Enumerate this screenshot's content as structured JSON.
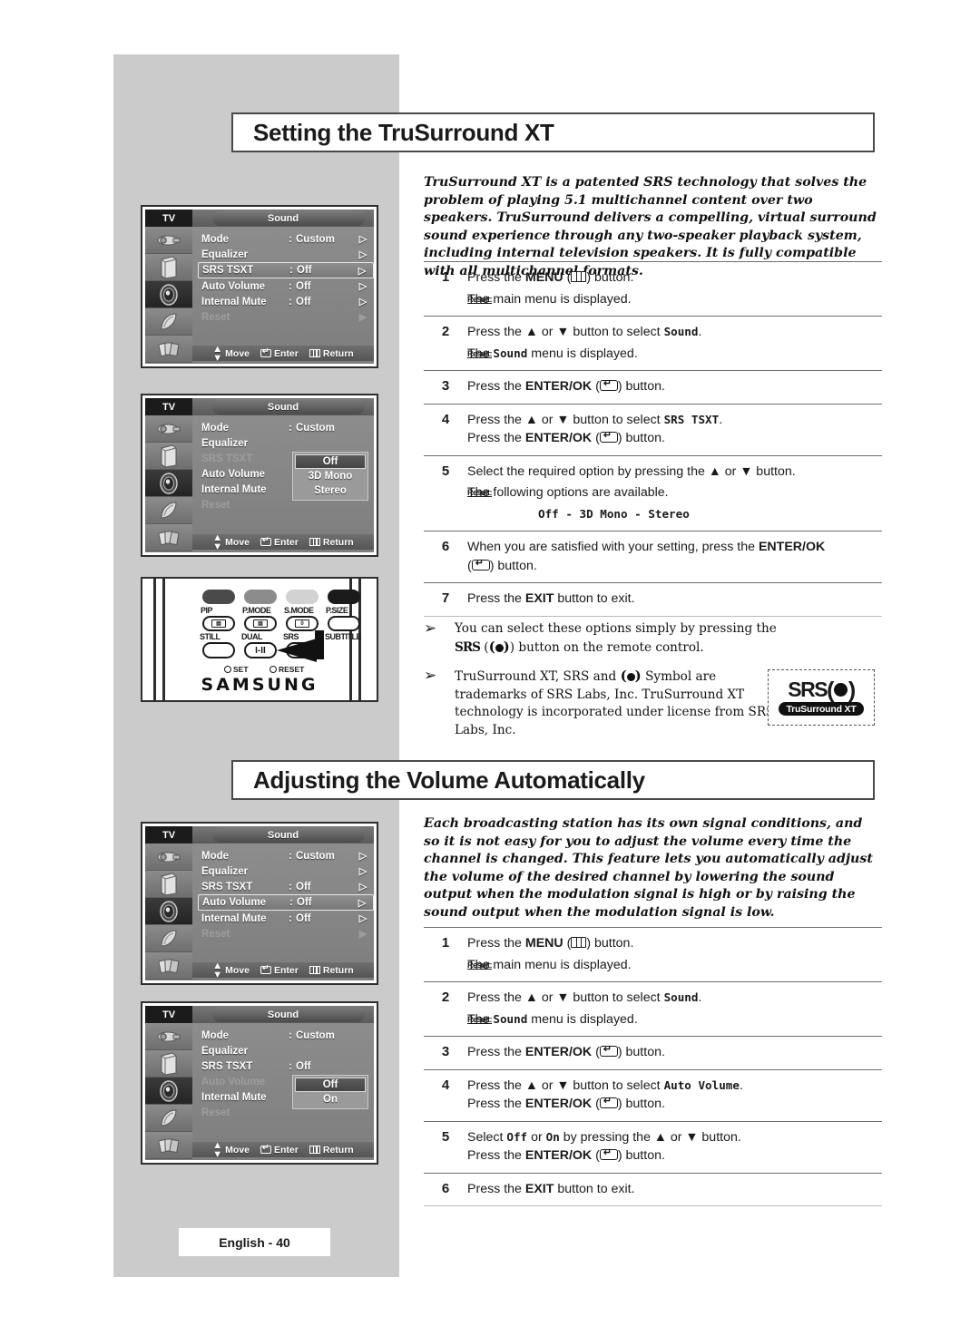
{
  "page": {
    "footer_label": "English - 40",
    "colors": {
      "panel_gray": "#cbcbcb",
      "ink": "#1a1a1a",
      "rule": "#6e6e6e"
    }
  },
  "sections": [
    {
      "title": "Setting the TruSurround XT",
      "intro": "TruSurround XT is a patented SRS technology that solves the problem of playing 5.1 multichannel content over two speakers. TruSurround delivers a compelling, virtual surround sound  experience through any two-speaker playback system, including internal television speakers. It is fully compatible with all multichannel formats."
    },
    {
      "title": "Adjusting the Volume Automatically",
      "intro": "Each broadcasting station has its own signal conditions, and so it is not easy for you to adjust the volume every time the channel  is changed. This feature lets you automatically adjust the volume of the desired channel by lowering the sound output when the modulation signal is high or by raising the sound output when the modulation signal is low."
    }
  ],
  "steps1": {
    "s1_num": "1",
    "s1_a": "Press the ",
    "s1_menu": "MENU",
    "s1_b": ") button.",
    "s1_res_lbl": "Result:",
    "s1_res": "The main menu is displayed.",
    "s2_num": "2",
    "s2_a": "Press the ▲ or ▼ button to select ",
    "s2_target": "Sound",
    "s2_b": ".",
    "s2_res_lbl": "Result:",
    "s2_res_a": "The ",
    "s2_res_target": "Sound",
    "s2_res_b": " menu is displayed.",
    "s3_num": "3",
    "s3_a": "Press the ",
    "s3_enter": "ENTER/OK",
    "s3_b": ") button.",
    "s4_num": "4",
    "s4_a": "Press the ▲ or ▼ button to select ",
    "s4_target": "SRS TSXT",
    "s4_b": ".",
    "s4_c": "Press the ",
    "s4_enter": "ENTER/OK",
    "s4_d": ") button.",
    "s5_num": "5",
    "s5_a": "Select the required option by pressing the ▲ or ▼ button.",
    "s5_res_lbl": "Result:",
    "s5_res": "The following options are available.",
    "s5_options": "Off - 3D Mono - Stereo",
    "s6_num": "6",
    "s6_a": "When you are satisfied with your setting, press the ",
    "s6_enter": "ENTER/OK",
    "s6_b": ") button.",
    "s7_num": "7",
    "s7_a": "Press the ",
    "s7_exit": "EXIT",
    "s7_b": " button to exit."
  },
  "steps2": {
    "s1_num": "1",
    "s1_a": "Press the ",
    "s1_menu": "MENU",
    "s1_b": ") button.",
    "s1_res_lbl": "Result:",
    "s1_res": "The main menu is displayed.",
    "s2_num": "2",
    "s2_a": "Press the ▲ or ▼ button to select ",
    "s2_target": "Sound",
    "s2_b": ".",
    "s2_res_lbl": "Result:",
    "s2_res_a": "The ",
    "s2_res_target": "Sound",
    "s2_res_b": " menu is displayed.",
    "s3_num": "3",
    "s3_a": "Press the ",
    "s3_enter": "ENTER/OK",
    "s3_b": ") button.",
    "s4_num": "4",
    "s4_a": "Press the ▲ or ▼ button to select ",
    "s4_target": "Auto Volume",
    "s4_b": ".",
    "s4_c": "Press the ",
    "s4_enter": "ENTER/OK",
    "s4_d": ") button.",
    "s5_num": "5",
    "s5_a": "Select ",
    "s5_off": "Off",
    "s5_mid": " or ",
    "s5_on": "On",
    "s5_b": " by pressing the ▲ or ▼ button.",
    "s5_c": "Press the ",
    "s5_enter": "ENTER/OK",
    "s5_d": ") button.",
    "s6_num": "6",
    "s6_a": "Press the ",
    "s6_exit": "EXIT",
    "s6_b": " button to exit."
  },
  "notes": [
    {
      "bullet": "➢",
      "text_a": "You can select these options simply by pressing the ",
      "srs": "SRS",
      "text_b": " button on the remote control."
    },
    {
      "bullet": "➢",
      "text_a": "TruSurround XT, SRS and ",
      "text_b": " Symbol are trademarks of SRS Labs, Inc. TruSurround XT technology is incorporated under license from SRS Labs, Inc."
    }
  ],
  "srs_logo": {
    "name": "SRS",
    "tagline": "TruSurround XT"
  },
  "osd_common": {
    "tv_label": "TV",
    "menu_title": "Sound",
    "foot_move": "Move",
    "foot_enter": "Enter",
    "foot_return": "Return",
    "colon": ":",
    "arrow": "▷",
    "arrow_solid": "▶"
  },
  "osd1": {
    "rows": [
      {
        "label": "Mode",
        "value": "Custom",
        "state": "normal",
        "arrow": "open"
      },
      {
        "label": "Equalizer",
        "value": "",
        "state": "normal",
        "arrow": "open"
      },
      {
        "label": "SRS TSXT",
        "value": "Off",
        "state": "highlight",
        "arrow": "open"
      },
      {
        "label": "Auto Volume",
        "value": "Off",
        "state": "normal",
        "arrow": "open"
      },
      {
        "label": "Internal Mute",
        "value": "Off",
        "state": "normal",
        "arrow": "open"
      },
      {
        "label": "Reset",
        "value": "",
        "state": "dim",
        "arrow": "solid"
      }
    ]
  },
  "osd2": {
    "rows": [
      {
        "label": "Mode",
        "value": "Custom",
        "state": "normal"
      },
      {
        "label": "Equalizer",
        "value": "",
        "state": "normal"
      },
      {
        "label": "SRS TSXT",
        "value": "",
        "state": "dim"
      },
      {
        "label": "Auto Volume",
        "value": "",
        "state": "normal"
      },
      {
        "label": "Internal Mute",
        "value": "",
        "state": "normal"
      },
      {
        "label": "Reset",
        "value": "",
        "state": "dim"
      }
    ],
    "popup": [
      {
        "label": "Off",
        "selected": true
      },
      {
        "label": "3D Mono",
        "selected": false
      },
      {
        "label": "Stereo",
        "selected": false
      }
    ]
  },
  "osd3": {
    "rows": [
      {
        "label": "Mode",
        "value": "Custom",
        "state": "normal",
        "arrow": "open"
      },
      {
        "label": "Equalizer",
        "value": "",
        "state": "normal",
        "arrow": "open"
      },
      {
        "label": "SRS TSXT",
        "value": "Off",
        "state": "normal",
        "arrow": "open"
      },
      {
        "label": "Auto Volume",
        "value": "Off",
        "state": "highlight",
        "arrow": "open"
      },
      {
        "label": "Internal Mute",
        "value": "Off",
        "state": "normal",
        "arrow": "open"
      },
      {
        "label": "Reset",
        "value": "",
        "state": "dim",
        "arrow": "solid"
      }
    ]
  },
  "osd4": {
    "rows": [
      {
        "label": "Mode",
        "value": "Custom",
        "state": "normal"
      },
      {
        "label": "Equalizer",
        "value": "",
        "state": "normal"
      },
      {
        "label": "SRS TSXT",
        "value": "Off",
        "state": "normal"
      },
      {
        "label": "Auto Volume",
        "value": "",
        "state": "dim"
      },
      {
        "label": "Internal Mute",
        "value": "",
        "state": "normal"
      },
      {
        "label": "Reset",
        "value": "",
        "state": "dim"
      }
    ],
    "popup": [
      {
        "label": "Off",
        "selected": true
      },
      {
        "label": "On",
        "selected": false
      }
    ]
  },
  "remote": {
    "top_labels": [
      "PIP",
      "P.MODE",
      "S.MODE",
      "P.SIZE"
    ],
    "mid_labels": [
      "STILL",
      "DUAL",
      "SRS",
      "SUBTITLE"
    ],
    "dual_text": "I-II",
    "set_label": "SET",
    "reset_label": "RESET",
    "brand": "SAMSUNG"
  }
}
